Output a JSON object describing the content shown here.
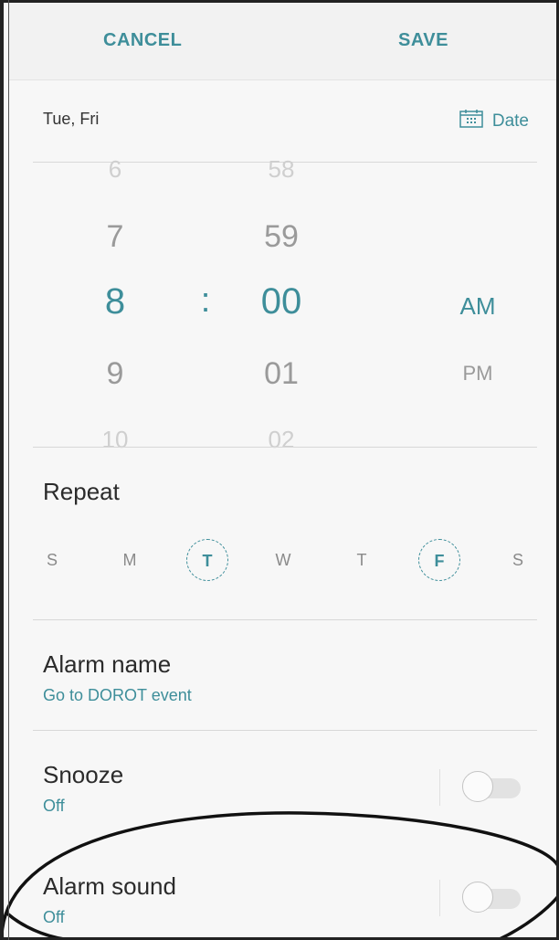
{
  "topbar": {
    "cancel_label": "CANCEL",
    "save_label": "SAVE"
  },
  "date_row": {
    "days_text": "Tue, Fri",
    "date_label": "Date"
  },
  "time_picker": {
    "hours": [
      "6",
      "7",
      "8",
      "9",
      "10"
    ],
    "minutes": [
      "58",
      "59",
      "00",
      "01",
      "02"
    ],
    "selected_hour": "8",
    "selected_minute": "00",
    "separator": ":",
    "ampm": [
      "AM",
      "PM"
    ],
    "selected_ampm": "AM"
  },
  "repeat": {
    "title": "Repeat",
    "days": [
      {
        "label": "S",
        "selected": false
      },
      {
        "label": "M",
        "selected": false
      },
      {
        "label": "T",
        "selected": true
      },
      {
        "label": "W",
        "selected": false
      },
      {
        "label": "T",
        "selected": false
      },
      {
        "label": "F",
        "selected": true
      },
      {
        "label": "S",
        "selected": false
      }
    ]
  },
  "alarm_name": {
    "title": "Alarm name",
    "value": "Go to DOROT event"
  },
  "snooze": {
    "title": "Snooze",
    "status": "Off",
    "enabled": false
  },
  "alarm_sound": {
    "title": "Alarm sound",
    "status": "Off",
    "enabled": false
  },
  "colors": {
    "accent": "#3e8e9a",
    "background": "#f7f7f7",
    "annotation": "#111111"
  }
}
